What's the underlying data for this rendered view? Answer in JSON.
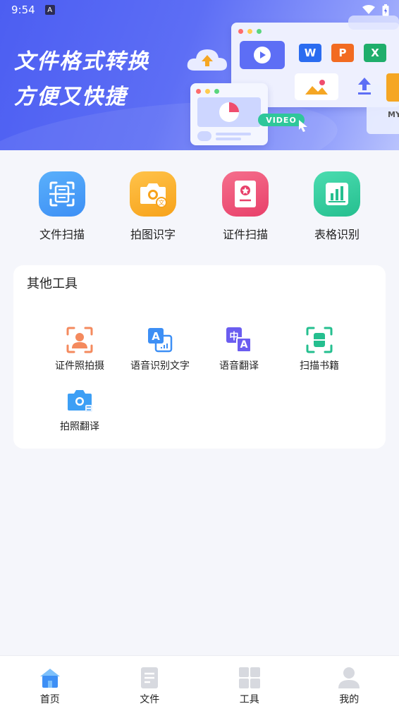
{
  "status_bar": {
    "time": "9:54",
    "notif_letter": "A"
  },
  "banner": {
    "title_line1": "文件格式转换",
    "title_line2": "方便又快捷",
    "video_tag": "VIDEO",
    "w": "W",
    "p": "P",
    "x": "X",
    "my": "MY"
  },
  "quick_tools": [
    {
      "label": "文件扫描",
      "icon": "document-scan-icon",
      "color": "#3d8ff5"
    },
    {
      "label": "拍图识字",
      "icon": "camera-text-icon",
      "color": "#f7a21a"
    },
    {
      "label": "证件扫描",
      "icon": "id-card-scan-icon",
      "color": "#ef4d6e"
    },
    {
      "label": "表格识别",
      "icon": "table-chart-icon",
      "color": "#2fc79a"
    }
  ],
  "other_tools": {
    "title": "其他工具",
    "items": [
      {
        "label": "证件照拍摄",
        "icon": "id-photo-icon"
      },
      {
        "label": "语音识别文字",
        "icon": "voice-to-text-icon"
      },
      {
        "label": "语音翻译",
        "icon": "voice-translate-icon"
      },
      {
        "label": "扫描书籍",
        "icon": "book-scan-icon"
      },
      {
        "label": "拍照翻译",
        "icon": "photo-translate-icon"
      }
    ],
    "glyph_zh": "中",
    "glyph_a": "A"
  },
  "bottom_nav": [
    {
      "label": "首页",
      "icon": "home-icon",
      "active": true
    },
    {
      "label": "文件",
      "icon": "file-icon",
      "active": false
    },
    {
      "label": "工具",
      "icon": "grid-tools-icon",
      "active": false
    },
    {
      "label": "我的",
      "icon": "profile-icon",
      "active": false
    }
  ],
  "colors": {
    "accent": "#4c5ef2",
    "inactive_icon": "#d7d9df",
    "active_icon": "#4fa3f7"
  }
}
